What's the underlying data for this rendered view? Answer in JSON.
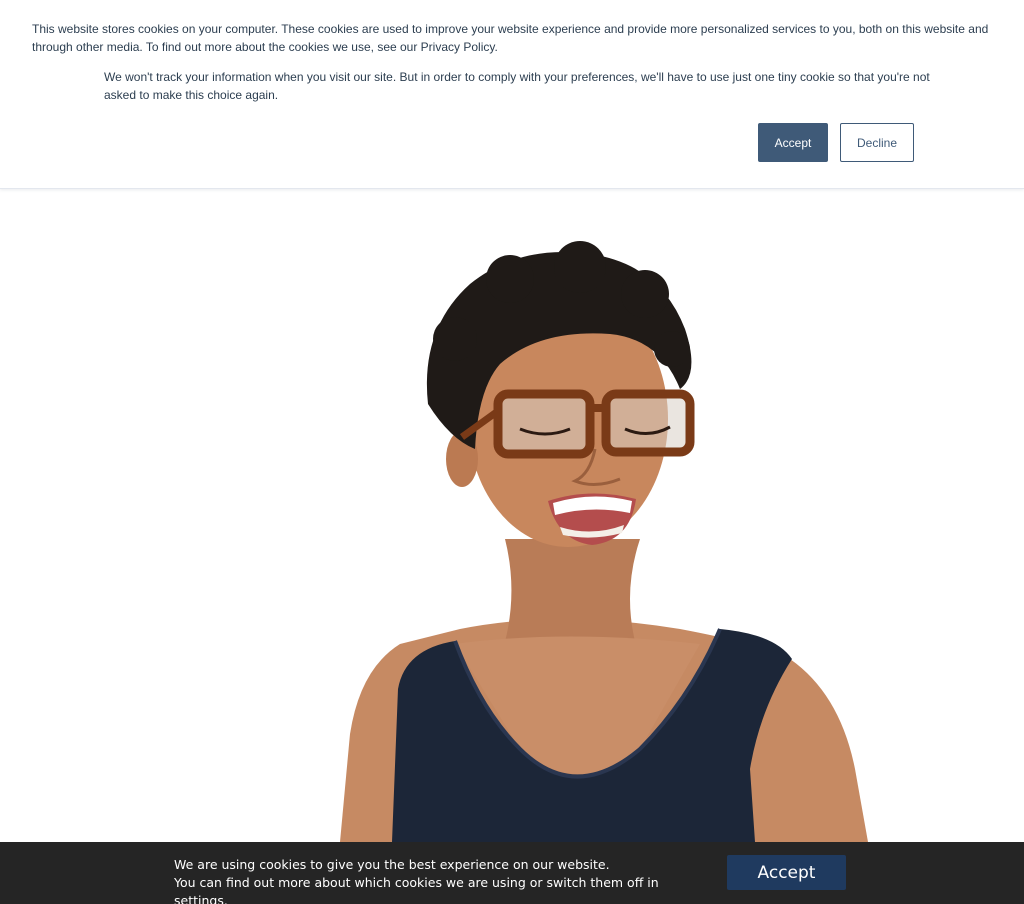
{
  "cookie_banner": {
    "message": "This website stores cookies on your computer. These cookies are used to improve your website experience and provide more personalized services to you, both on this website and through other media. To find out more about the cookies we use, see our Privacy Policy.",
    "notice": "We won't track your information when you visit our site. But in order to comply with your preferences, we'll have to use just one tiny cookie so that you're not asked to make this choice again.",
    "accept_label": "Accept",
    "decline_label": "Decline",
    "accept_color": "#3f5a78"
  },
  "hero": {
    "image": "smiling-woman-with-glasses-photo"
  },
  "cookie_bar": {
    "line1": "We are using cookies to give you the best experience on our website.",
    "line2_prefix": "You can find out more about which cookies we are using or switch them off in ",
    "settings_link": "settings",
    "line2_suffix": ".",
    "accept_label": "Accept",
    "background": "#252525",
    "button_color": "#1f3a5f"
  }
}
